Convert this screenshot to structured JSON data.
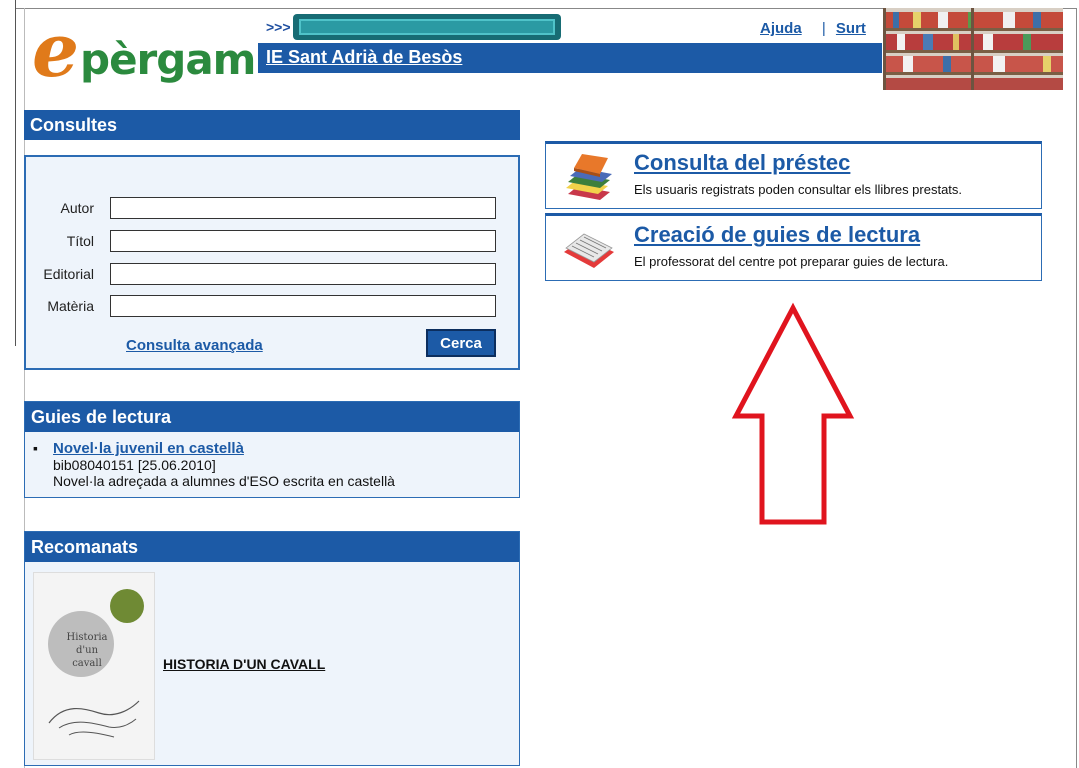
{
  "header": {
    "logo_text": "pèrgam",
    "logo_initial": "e",
    "crumb_prefix": ">>>",
    "school_name": "IE Sant Adrià de Besòs",
    "links": {
      "help": "Ajuda",
      "separator": "|",
      "exit": "Surt"
    }
  },
  "consultes": {
    "title": "Consultes",
    "fields": [
      {
        "label": "Autor",
        "value": ""
      },
      {
        "label": "Títol",
        "value": ""
      },
      {
        "label": "Editorial",
        "value": ""
      },
      {
        "label": "Matèria",
        "value": ""
      }
    ],
    "advanced_link": "Consulta avançada",
    "search_button": "Cerca"
  },
  "guies": {
    "title": "Guies de lectura",
    "items": [
      {
        "title": "Novel·la juvenil en castellà",
        "meta": "bib08040151 [25.06.2010]",
        "description": "Novel·la adreçada a alumnes d'ESO escrita en castellà"
      }
    ]
  },
  "recomanats": {
    "title": "Recomanats",
    "book_cover_text": "Historia d'un cavall",
    "book_link": "HISTORIA D'UN CAVALL"
  },
  "cards": [
    {
      "title": "Consulta del préstec",
      "description": "Els usuaris registrats poden consultar els llibres prestats.",
      "icon": "books-stack-icon"
    },
    {
      "title": "Creació de guies de lectura",
      "description": "El professorat del centre pot preparar guies de lectura.",
      "icon": "open-book-icon"
    }
  ],
  "colors": {
    "primary": "#1c5aa6",
    "logo_orange": "#e07a1a",
    "logo_green": "#2b8a3e",
    "arrow_red": "#e0141e"
  }
}
